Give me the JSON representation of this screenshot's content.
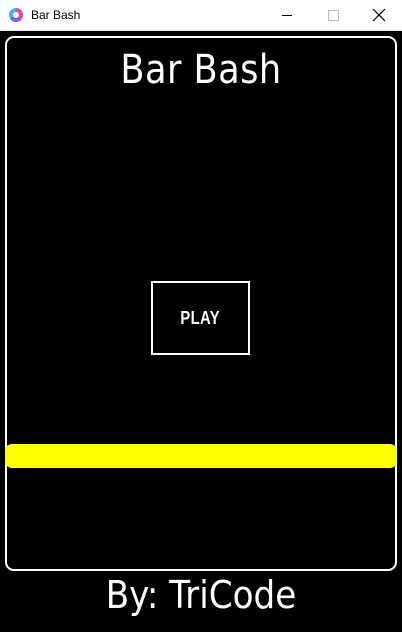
{
  "window": {
    "title": "Bar Bash",
    "icon": "app-icon",
    "controls": [
      "minimize-icon",
      "maximize-icon",
      "close-icon"
    ]
  },
  "game": {
    "title": "Bar Bash",
    "play_label": "PLAY",
    "credit": "By: TriCode"
  },
  "colors": {
    "background": "#000000",
    "foreground": "#ffffff",
    "bar": "#ffff00"
  }
}
